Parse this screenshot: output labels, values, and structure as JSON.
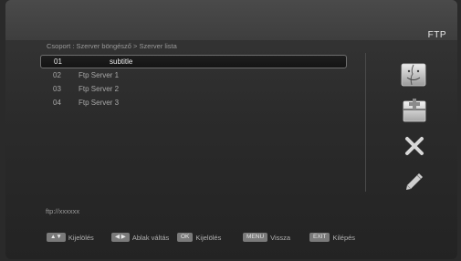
{
  "header": {
    "title": "FTP"
  },
  "breadcrumb": "Csoport : Szerver böngésző > Szerver lista",
  "servers": [
    {
      "num": "01",
      "name": "subtitle"
    },
    {
      "num": "02",
      "name": "Ftp Server 1"
    },
    {
      "num": "03",
      "name": "Ftp Server 2"
    },
    {
      "num": "04",
      "name": "Ftp Server 3"
    }
  ],
  "url": "ftp://xxxxxx",
  "side_icons": [
    "finder-icon",
    "add-server-icon",
    "delete-icon",
    "edit-pencil-icon"
  ],
  "footer": {
    "select_key": "▲▼",
    "select_label": "Kijelölés",
    "window_key": "◀ ▶",
    "window_label": "Ablak váltás",
    "ok_key": "OK",
    "ok_label": "Kijelölés",
    "menu_key": "MENU",
    "menu_label": "Vissza",
    "exit_key": "EXIT",
    "exit_label": "Kilépés"
  },
  "colors": {
    "background": "#2b2b2b",
    "selection_border": "#6e6e6e",
    "key_bg": "#7a7a7a"
  }
}
